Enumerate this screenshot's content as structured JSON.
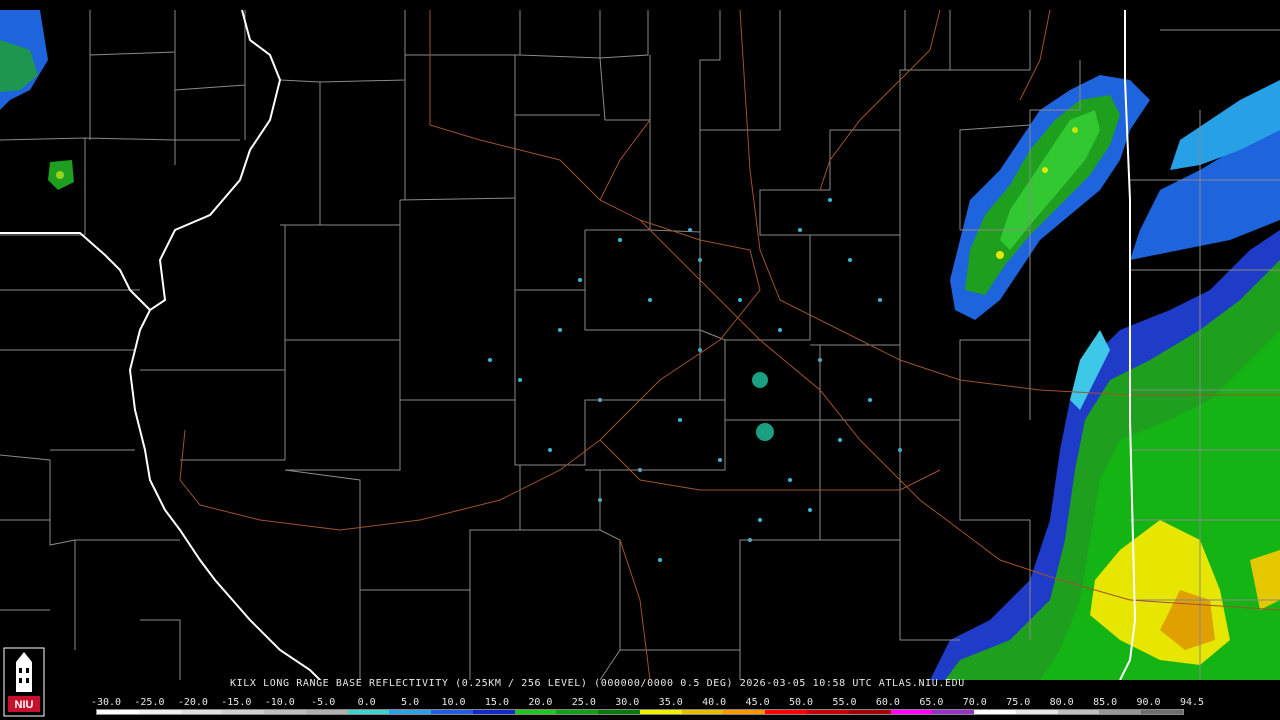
{
  "product_caption": "KILX LONG RANGE BASE REFLECTIVITY (0.25KM / 256 LEVEL) (000000/0000 0.5 DEG) 2026-03-05 10:58 UTC  ATLAS.NIU.EDU",
  "logo_text": "NIU",
  "scale": {
    "labels": [
      "-30.0",
      "-25.0",
      "-20.0",
      "-15.0",
      "-10.0",
      "-5.0",
      "0.0",
      "5.0",
      "10.0",
      "15.0",
      "20.0",
      "25.0",
      "30.0",
      "35.0",
      "40.0",
      "45.0",
      "50.0",
      "55.0",
      "60.0",
      "65.0",
      "70.0",
      "75.0",
      "80.0",
      "85.0",
      "90.0",
      "94.5"
    ],
    "colors": [
      "#ffffff",
      "#f0f0f0",
      "#e0e0e0",
      "#d0d0d0",
      "#c0c0c0",
      "#b0b0b0",
      "#3fd2d2",
      "#2ea0e8",
      "#1f5fe0",
      "#1428c8",
      "#1ec81e",
      "#14a014",
      "#0a780a",
      "#f0f000",
      "#e6be00",
      "#ff9600",
      "#ff0000",
      "#c80000",
      "#a00000",
      "#ff00ff",
      "#9632c8",
      "#ffffff",
      "#e6e6e6",
      "#bebebe",
      "#969696",
      "#6e6e6e"
    ]
  },
  "colors": {
    "county_lines": "#8a8a8a",
    "state_lines": "#ffffff",
    "highways": "#a0522d",
    "background": "#000000"
  }
}
